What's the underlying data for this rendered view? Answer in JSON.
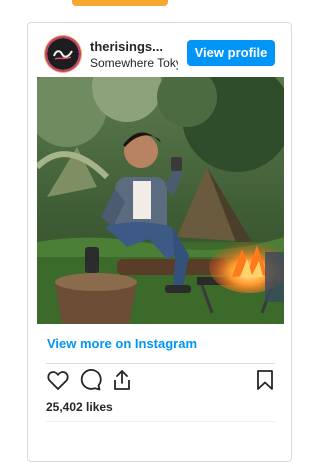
{
  "post": {
    "username": "therisings...",
    "location": "Somewhere Tokyo",
    "view_profile_label": "View profile",
    "view_more_label": "View more on Instagram",
    "likes": "25,402 likes"
  },
  "icons": {
    "like": "heart-icon",
    "comment": "comment-icon",
    "share": "share-icon",
    "save": "bookmark-icon"
  },
  "colors": {
    "accent": "#0095f6",
    "text": "#262626",
    "border": "#dbdbdb",
    "top_strip": "#f6a832"
  }
}
